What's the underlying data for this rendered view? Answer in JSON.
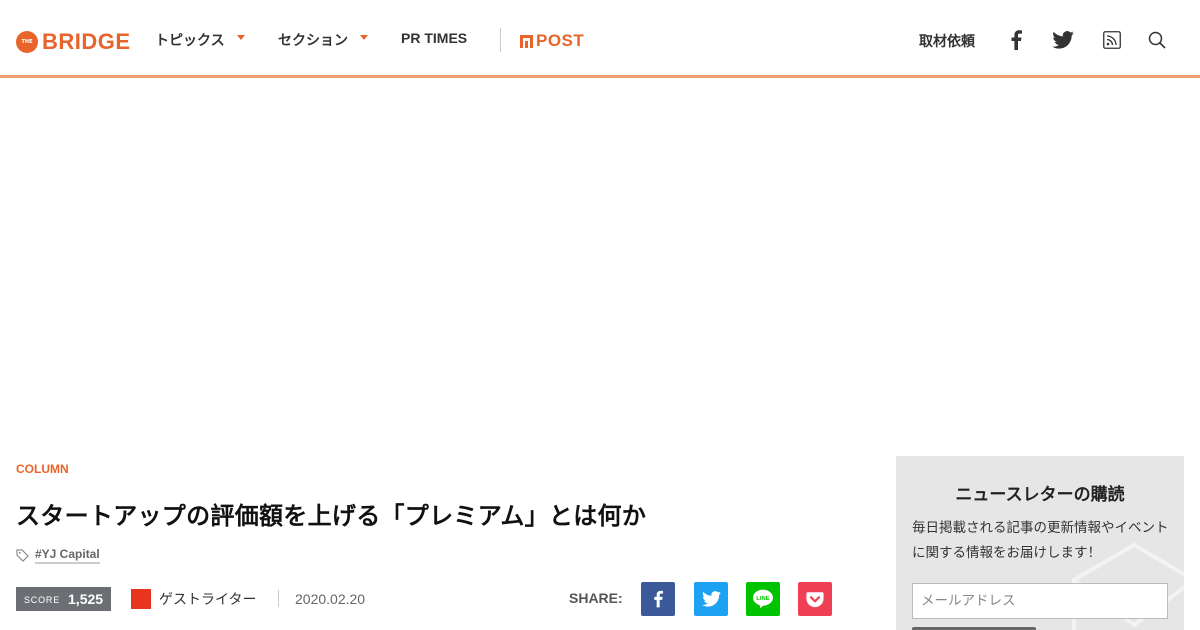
{
  "header": {
    "logo_text": "BRIDGE",
    "logo_mark_text": "THE",
    "nav": {
      "topics": "トピックス",
      "sections": "セクション",
      "prtimes": "PR TIMES"
    },
    "post_logo": "POST",
    "request_label": "取材依頼",
    "icons": [
      "facebook-icon",
      "twitter-icon",
      "rss-icon",
      "search-icon"
    ]
  },
  "article": {
    "category": "COLUMN",
    "title": "スタートアップの評価額を上げる「プレミアム」とは何か",
    "tag": "#YJ Capital",
    "score_label": "SCORE",
    "score_value": "1,525",
    "author": "ゲストライター",
    "date": "2020.02.20",
    "share_label": "SHARE:",
    "share_buttons": [
      "facebook",
      "twitter",
      "line",
      "pocket"
    ]
  },
  "newsletter": {
    "title": "ニュースレターの購読",
    "description": "毎日掲載される記事の更新情報やイベントに関する情報をお届けします！",
    "email_placeholder": "メールアドレス"
  },
  "colors": {
    "brand": "#e8642a",
    "facebook": "#3b5998",
    "twitter": "#1da1f2",
    "line": "#00c300",
    "pocket": "#ef4056",
    "score_bg": "#6b6f73",
    "sidebar_bg": "#e6e6e6"
  }
}
